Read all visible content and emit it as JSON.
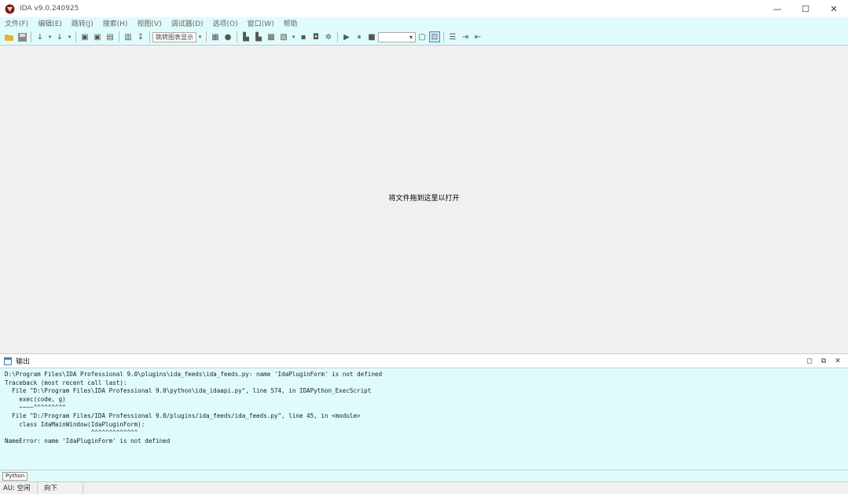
{
  "window": {
    "title": "IDA v9.0.240925",
    "controls": [
      "—",
      "☐",
      "✕"
    ]
  },
  "menubar": {
    "items": [
      "文件(F)",
      "编辑(E)",
      "跳转(J)",
      "搜索(H)",
      "视图(V)",
      "调试器(D)",
      "选项(O)",
      "窗口(W)",
      "帮助"
    ]
  },
  "toolbar": {
    "view_mode": "跳转图表显示",
    "debugger_select": ""
  },
  "main": {
    "drop_hint": "将文件拖到这里以打开"
  },
  "output": {
    "title": "输出",
    "lines": [
      "D:\\Program Files\\IDA Professional 9.0\\plugins\\ida_feeds\\ida_feeds.py: name 'IdaPluginForm' is not defined",
      "Traceback (most recent call last):",
      "  File \"D:\\Program Files\\IDA Professional 9.0\\python\\ida_idaapi.py\", line 574, in IDAPython_ExecScript",
      "    exec(code, g)",
      "    ~~~~^^^^^^^^^",
      "  File \"D:/Program Files/IDA Professional 9.0/plugins/ida_feeds/ida_feeds.py\", line 45, in <module>",
      "    class IdaMainWindow(IdaPluginForm):",
      "                        ^^^^^^^^^^^^^",
      "NameError: name 'IdaPluginForm' is not defined"
    ]
  },
  "cmdbar": {
    "language": "Python"
  },
  "status": {
    "state": "AU: 空闲",
    "direction": "向下"
  },
  "colors": {
    "panel_bg": "#e0fbfb",
    "main_bg": "#f0f0f0"
  }
}
